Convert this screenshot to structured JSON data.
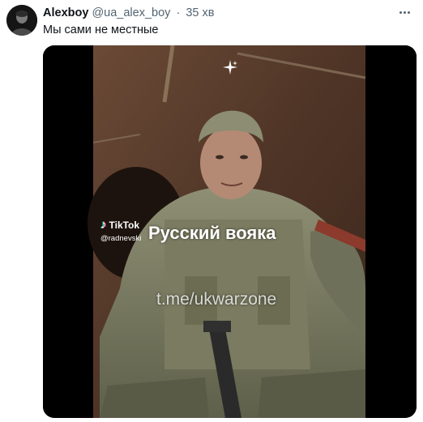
{
  "tweet": {
    "display_name": "Alexboy",
    "handle": "@ua_alex_boy",
    "separator": "·",
    "time": "35 хв",
    "text": "Мы сами не местные",
    "more_icon": "more-horizontal-icon",
    "avatar_icon": "user-avatar"
  },
  "media": {
    "tiktok_brand": "TikTok",
    "tiktok_icon": "tiktok-icon",
    "tiktok_user": "@radnevski",
    "caption": "Русский вояка",
    "watermark": "t.me/ukwarzone",
    "sparkle_icon": "sparkle-icon"
  },
  "colors": {
    "text_primary": "#0f1419",
    "text_secondary": "#536471",
    "background": "#ffffff",
    "media_frame": "#000000"
  }
}
